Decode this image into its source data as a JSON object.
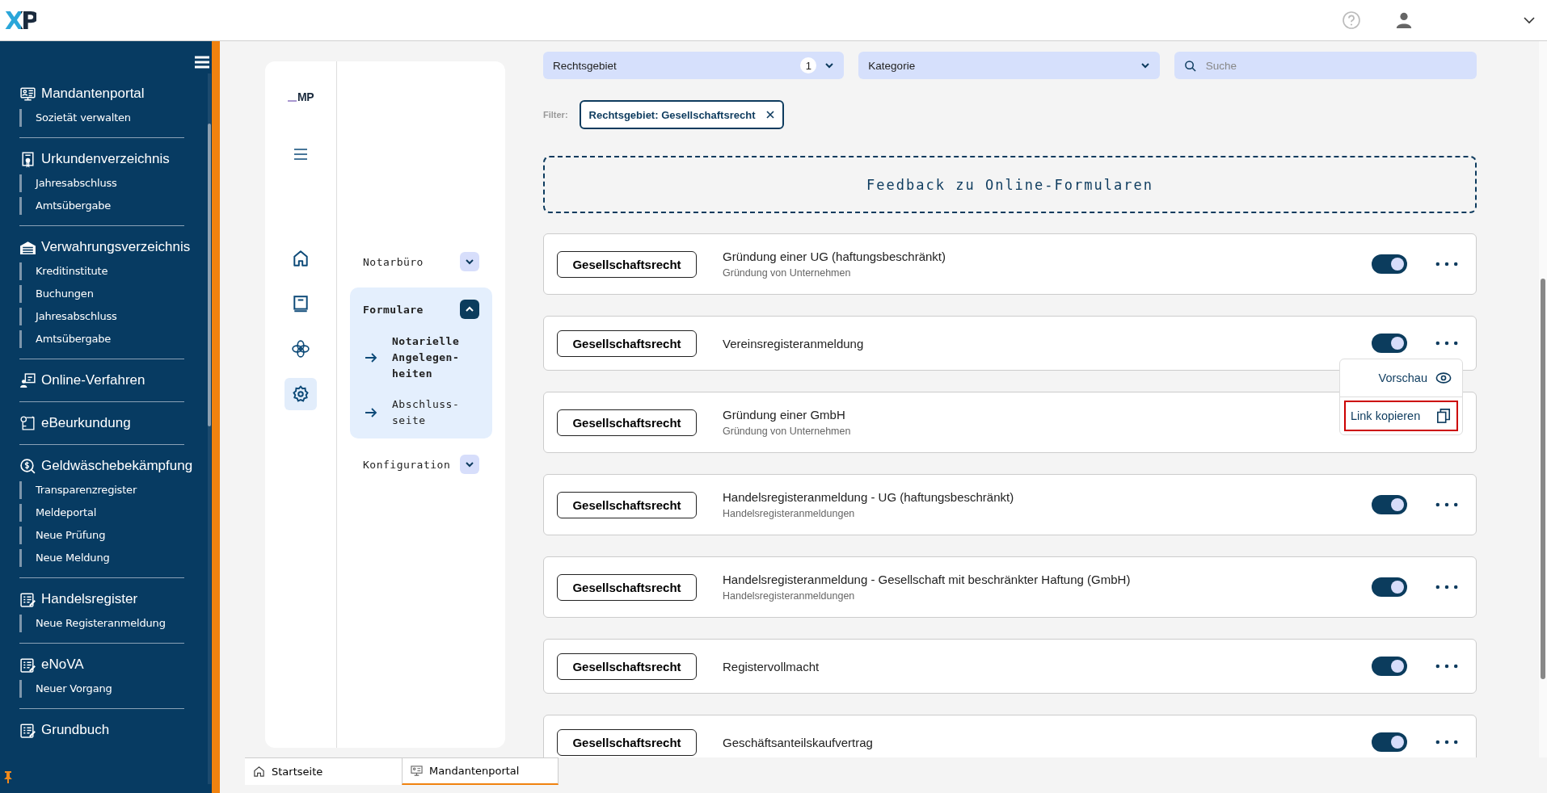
{
  "header": {
    "logo": "XP"
  },
  "sidebar": {
    "sections": [
      {
        "label": "Mandantenportal",
        "kind": "portal",
        "items": [
          "Sozietät verwalten"
        ]
      },
      {
        "label": "Urkundenverzeichnis",
        "kind": "certificate",
        "items": [
          "Jahresabschluss",
          "Amtsübergabe"
        ]
      },
      {
        "label": "Verwahrungsverzeichnis",
        "kind": "vault",
        "items": [
          "Kreditinstitute",
          "Buchungen",
          "Jahresabschluss",
          "Amtsübergabe"
        ]
      },
      {
        "label": "Online-Verfahren",
        "kind": "online"
      },
      {
        "label": "eBeurkundung",
        "kind": "scroll"
      },
      {
        "label": "Geldwäschebekämpfung",
        "kind": "money",
        "items": [
          "Transparenzregister",
          "Meldeportal",
          "Neue Prüfung",
          "Neue Meldung"
        ]
      },
      {
        "label": "Handelsregister",
        "kind": "register",
        "items": [
          "Neue Registeranmeldung"
        ]
      },
      {
        "label": "eNoVA",
        "kind": "register",
        "items": [
          "Neuer Vorgang"
        ]
      },
      {
        "label": "Grundbuch",
        "kind": "register"
      }
    ]
  },
  "panel": {
    "logo": "MP",
    "rail": [
      {
        "kind": "home",
        "selected": false
      },
      {
        "kind": "book",
        "selected": false
      },
      {
        "kind": "knot",
        "selected": false
      },
      {
        "kind": "gear",
        "selected": true
      }
    ],
    "nav": [
      {
        "label": "Notarbüro",
        "expanded": false
      },
      {
        "label": "Formulare",
        "expanded": true,
        "children": [
          {
            "label": "Notarielle Angelegen-heiten",
            "bold": true
          },
          {
            "label": "Abschluss-seite",
            "bold": false
          }
        ]
      },
      {
        "label": "Konfiguration",
        "expanded": false
      }
    ]
  },
  "filters": {
    "dropdowns": [
      {
        "label": "Rechtsgebiet",
        "count": "1"
      },
      {
        "label": "Kategorie"
      }
    ],
    "search": {
      "placeholder": "Suche"
    },
    "active_label": "Filter:",
    "chips": [
      "Rechtsgebiet: Gesellschaftsrecht"
    ]
  },
  "feedback": "Feedback zu Online-Formularen",
  "forms": [
    {
      "category": "Gesellschaftsrecht",
      "title": "Gründung einer UG (haftungsbeschränkt)",
      "subtitle": "Gründung von Unternehmen",
      "enabled": true,
      "menu_open": false
    },
    {
      "category": "Gesellschaftsrecht",
      "title": "Vereinsregisteranmeldung",
      "enabled": true,
      "menu_open": true
    },
    {
      "category": "Gesellschaftsrecht",
      "title": "Gründung einer GmbH",
      "subtitle": "Gründung von Unternehmen",
      "menu_open": false
    },
    {
      "category": "Gesellschaftsrecht",
      "title": "Handelsregisteranmeldung - UG (haftungsbeschränkt)",
      "subtitle": "Handelsregisteranmeldungen",
      "enabled": true,
      "menu_open": false
    },
    {
      "category": "Gesellschaftsrecht",
      "title": "Handelsregisteranmeldung - Gesellschaft mit beschränkter Haftung (GmbH)",
      "subtitle": "Handelsregisteranmeldungen",
      "enabled": true,
      "menu_open": false
    },
    {
      "category": "Gesellschaftsrecht",
      "title": "Registervollmacht",
      "enabled": true,
      "menu_open": false
    },
    {
      "category": "Gesellschaftsrecht",
      "title": "Geschäftsanteilskaufvertrag",
      "enabled": true,
      "menu_open": false
    }
  ],
  "menu": [
    {
      "label": "Vorschau",
      "kind": "eye",
      "focused": false
    },
    {
      "label": "Link kopieren",
      "kind": "copy",
      "focused": true
    }
  ],
  "tabs": [
    {
      "label": "Startseite",
      "kind": "home",
      "selected": false
    },
    {
      "label": "Mandantenportal",
      "kind": "portal",
      "selected": true
    }
  ]
}
